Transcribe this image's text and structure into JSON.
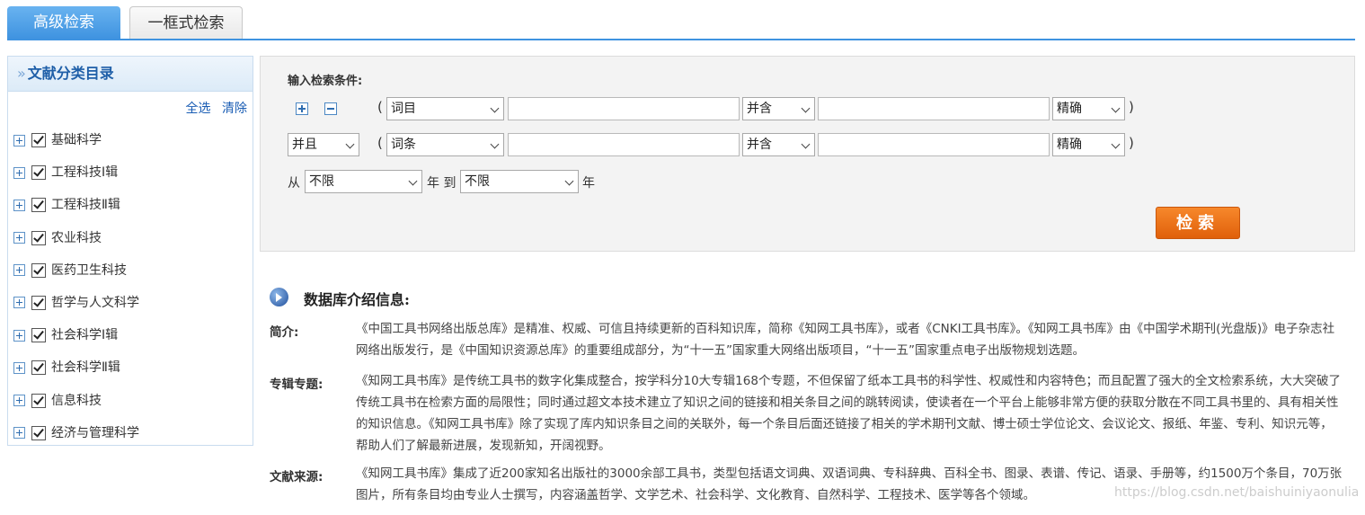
{
  "tabs": {
    "advanced": "高级检索",
    "single_box": "一框式检索"
  },
  "sidebar": {
    "title": "文献分类目录",
    "select_all": "全选",
    "clear": "清除",
    "categories": [
      {
        "label": "基础科学",
        "checked": true
      },
      {
        "label": "工程科技Ⅰ辑",
        "checked": true
      },
      {
        "label": "工程科技Ⅱ辑",
        "checked": true
      },
      {
        "label": "农业科技",
        "checked": true
      },
      {
        "label": "医药卫生科技",
        "checked": true
      },
      {
        "label": "哲学与人文科学",
        "checked": true
      },
      {
        "label": "社会科学Ⅰ辑",
        "checked": true
      },
      {
        "label": "社会科学Ⅱ辑",
        "checked": true
      },
      {
        "label": "信息科技",
        "checked": true
      },
      {
        "label": "经济与管理科学",
        "checked": true
      }
    ]
  },
  "search": {
    "title": "输入检索条件:",
    "open_paren": "(",
    "close_paren": ")",
    "row1": {
      "field": "词目",
      "relation": "并含",
      "match": "精确"
    },
    "row2": {
      "logic": "并且",
      "field": "词条",
      "relation": "并含",
      "match": "精确"
    },
    "year": {
      "from_label": "从",
      "from_value": "不限",
      "mid_label": "年 到",
      "to_value": "不限",
      "end_label": "年"
    },
    "button_label": "检索"
  },
  "info": {
    "title": "数据库介绍信息:",
    "sections": [
      {
        "label": "简介:",
        "text": "《中国工具书网络出版总库》是精准、权威、可信且持续更新的百科知识库，简称《知网工具书库》，或者《CNKI工具书库》。《知网工具书库》由《中国学术期刊(光盘版)》电子杂志社网络出版发行，是《中国知识资源总库》的重要组成部分，为“十一五”国家重大网络出版项目，“十一五”国家重点电子出版物规划选题。"
      },
      {
        "label": "专辑专题:",
        "text": "《知网工具书库》是传统工具书的数字化集成整合，按学科分10大专辑168个专题，不但保留了纸本工具书的科学性、权威性和内容特色；而且配置了强大的全文检索系统，大大突破了传统工具书在检索方面的局限性；同时通过超文本技术建立了知识之间的链接和相关条目之间的跳转阅读，使读者在一个平台上能够非常方便的获取分散在不同工具书里的、具有相关性的知识信息。《知网工具书库》除了实现了库内知识条目之间的关联外，每一个条目后面还链接了相关的学术期刊文献、博士硕士学位论文、会议论文、报纸、年鉴、专利、知识元等，帮助人们了解最新进展，发现新知，开阔视野。"
      },
      {
        "label": "文献来源:",
        "text": "《知网工具书库》集成了近200家知名出版社的3000余部工具书，类型包括语文词典、双语词典、专科辞典、百科全书、图录、表谱、传记、语录、手册等，约1500万个条目，70万张图片，所有条目均由专业人士撰写，内容涵盖哲学、文学艺术、社会科学、文化教育、自然科学、工程技术、医学等各个领域。"
      }
    ]
  },
  "watermark": "https://blog.csdn.net/baishuiniyaonulia"
}
